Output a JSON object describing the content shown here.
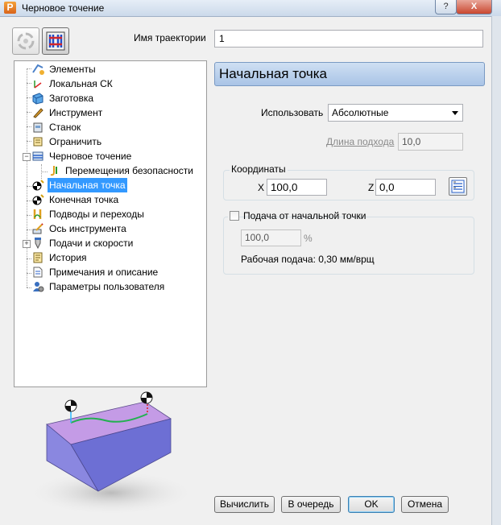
{
  "window": {
    "title": "Черновое точение",
    "app_icon_letter": "P",
    "help_label": "?",
    "close_label": "X"
  },
  "trajectory": {
    "label": "Имя траектории",
    "value": "1"
  },
  "tree": {
    "items": [
      {
        "label": "Элементы",
        "icon": "elements-icon"
      },
      {
        "label": "Локальная СК",
        "icon": "local-cs-icon"
      },
      {
        "label": "Заготовка",
        "icon": "stock-icon"
      },
      {
        "label": "Инструмент",
        "icon": "tool-icon"
      },
      {
        "label": "Станок",
        "icon": "machine-icon"
      },
      {
        "label": "Ограничить",
        "icon": "limit-icon"
      },
      {
        "label": "Черновое точение",
        "icon": "rough-turning-icon"
      },
      {
        "label": "Перемещения безопасности",
        "icon": "safety-moves-icon"
      },
      {
        "label": "Начальная точка",
        "icon": "start-point-icon"
      },
      {
        "label": "Конечная точка",
        "icon": "end-point-icon"
      },
      {
        "label": "Подводы и переходы",
        "icon": "leads-links-icon"
      },
      {
        "label": "Ось инструмента",
        "icon": "tool-axis-icon"
      },
      {
        "label": "Подачи и скорости",
        "icon": "feeds-speeds-icon"
      },
      {
        "label": "История",
        "icon": "history-icon"
      },
      {
        "label": "Примечания и описание",
        "icon": "notes-icon"
      },
      {
        "label": "Параметры пользователя",
        "icon": "user-params-icon"
      }
    ],
    "selected": "Начальная точка"
  },
  "panel": {
    "header": "Начальная точка",
    "use_label": "Использовать",
    "use_value": "Абсолютные",
    "approach_label": "Длина подхода",
    "approach_value": "10,0",
    "coords_title": "Координаты",
    "x_label": "X",
    "x_value": "100,0",
    "z_label": "Z",
    "z_value": "0,0",
    "feed_checkbox_label": "Подача от начальной точки",
    "feed_checked": false,
    "feed_value": "100,0",
    "feed_unit": "%",
    "work_feed": "Рабочая подача: 0,30 мм/врщ"
  },
  "buttons": {
    "calculate": "Вычислить",
    "queue": "В очередь",
    "ok": "OK",
    "cancel": "Отмена"
  },
  "colors": {
    "selection": "#3399ff",
    "header_gradient_top": "#cfe0f3",
    "header_gradient_bottom": "#a9c4e6",
    "block_face": "#8f8fe8"
  }
}
